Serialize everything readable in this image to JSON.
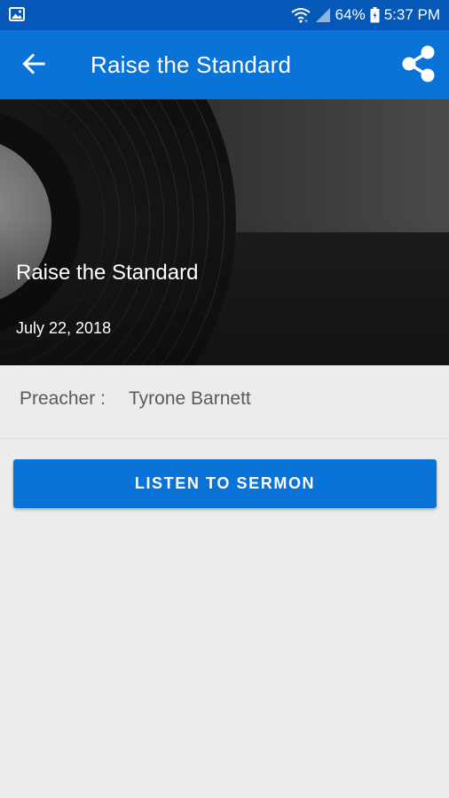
{
  "status_bar": {
    "battery": "64%",
    "time": "5:37 PM",
    "icons": [
      "image-icon",
      "wifi-icon",
      "signal-icon",
      "battery-icon"
    ]
  },
  "app_bar": {
    "title": "Raise the Standard",
    "back_icon": "arrow-back-icon",
    "share_icon": "share-icon"
  },
  "hero": {
    "title": "Raise the Standard",
    "date": "July 22, 2018",
    "image": "vinyl-record"
  },
  "details": {
    "preacher_label": "Preacher :",
    "preacher_name": "Tyrone Barnett"
  },
  "actions": {
    "listen_label": "LISTEN TO SERMON"
  },
  "colors": {
    "status_bar": "#0658b8",
    "app_bar": "#0a73d8",
    "button": "#0a73d8",
    "background": "#ececec"
  }
}
